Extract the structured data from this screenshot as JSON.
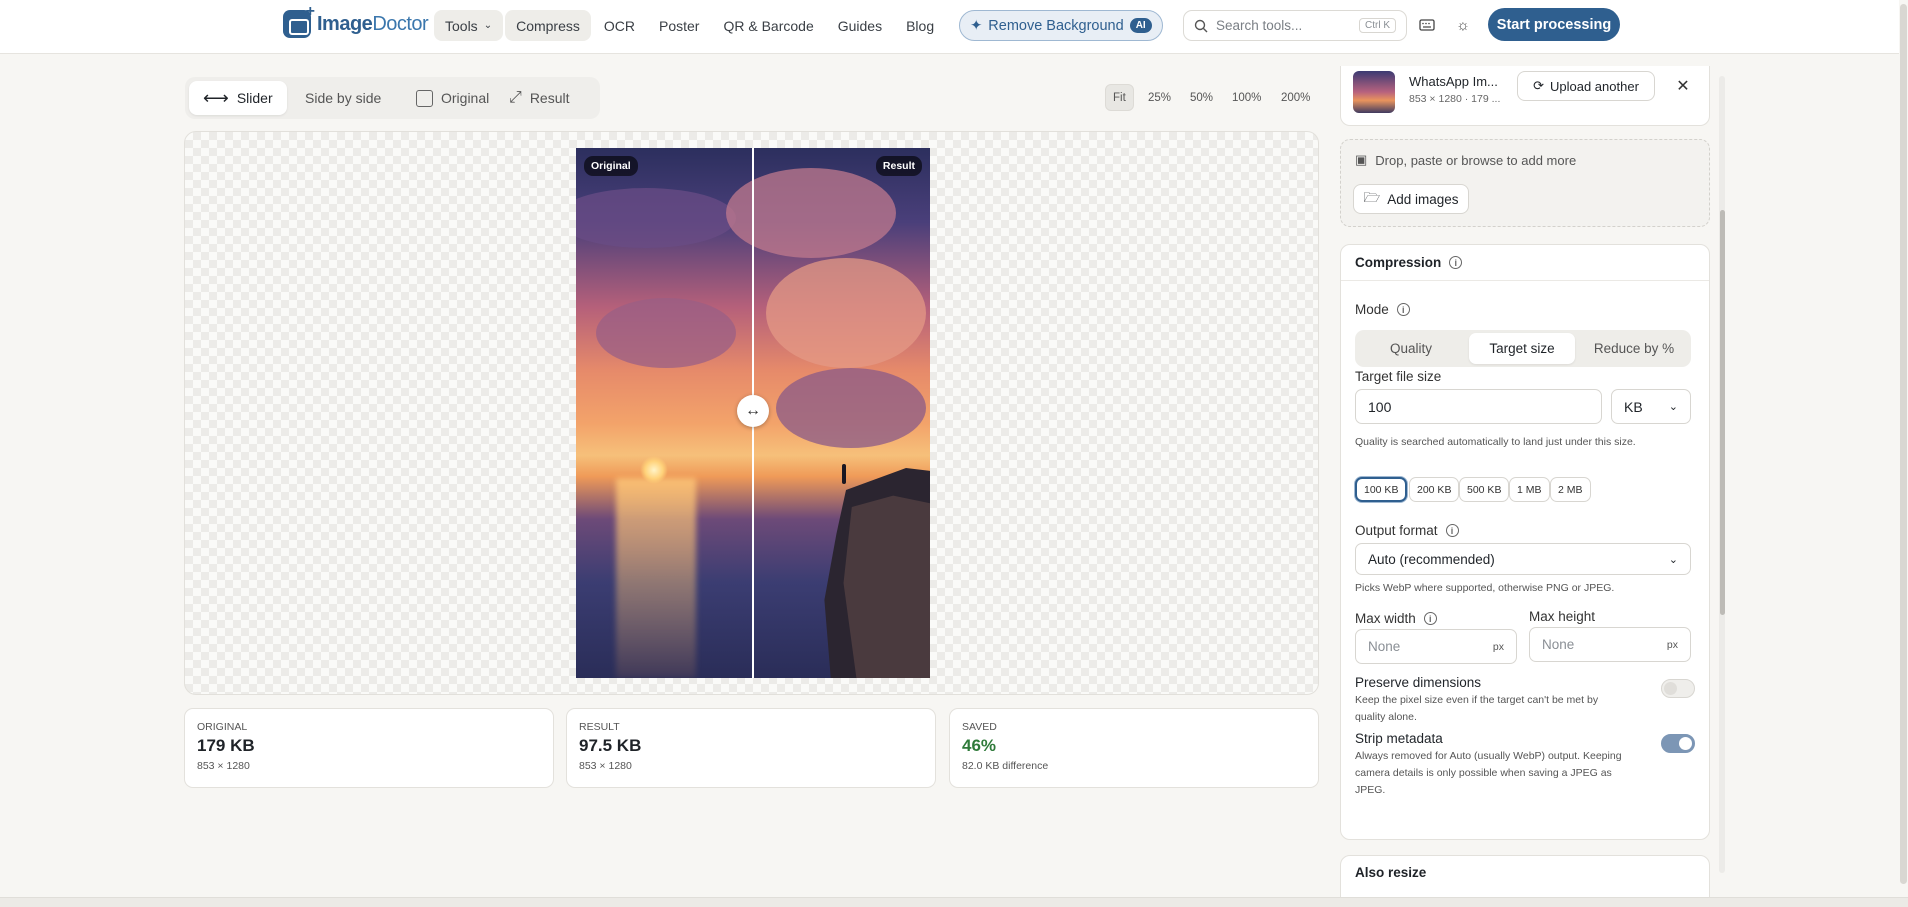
{
  "header": {
    "logo_a": "Image",
    "logo_b": "Doctor",
    "nav": [
      {
        "label": "Tools"
      },
      {
        "label": "Compress"
      },
      {
        "label": "OCR"
      },
      {
        "label": "Poster"
      },
      {
        "label": "QR & Barcode"
      },
      {
        "label": "Guides"
      },
      {
        "label": "Blog"
      }
    ],
    "remove_bg": "Remove Background",
    "ai_badge": "AI",
    "search_placeholder": "Search tools...",
    "search_kbd": "Ctrl K",
    "start": "Start processing"
  },
  "view": {
    "modes": [
      "Slider",
      "Side by side",
      "Original",
      "Result"
    ],
    "zoom": [
      "Fit",
      "25%",
      "50%",
      "100%",
      "200%"
    ],
    "label_original": "Original",
    "label_result": "Result"
  },
  "stats": [
    {
      "label": "ORIGINAL",
      "value": "179 KB",
      "sub": "853 × 1280"
    },
    {
      "label": "RESULT",
      "value": "97.5 KB",
      "sub": "853 × 1280"
    },
    {
      "label": "SAVED",
      "value": "46%",
      "sub": "82.0 KB difference"
    }
  ],
  "file": {
    "name": "WhatsApp Im...",
    "meta": "853 × 1280 · 179 ...",
    "upload": "Upload another"
  },
  "drop": {
    "text": "Drop, paste or browse to add more",
    "add": "Add images"
  },
  "compression": {
    "title": "Compression",
    "mode_label": "Mode",
    "modes": [
      "Quality",
      "Target size",
      "Reduce by %"
    ],
    "target_label": "Target file size",
    "target_value": "100",
    "unit": "KB",
    "target_hint": "Quality is searched automatically to land just under this size.",
    "presets": [
      "100 KB",
      "200 KB",
      "500 KB",
      "1 MB",
      "2 MB"
    ],
    "format_label": "Output format",
    "format_value": "Auto (recommended)",
    "format_hint": "Picks WebP where supported, otherwise PNG or JPEG.",
    "max_width": "Max width",
    "max_height": "Max height",
    "none_placeholder": "None",
    "px": "px",
    "preserve_title": "Preserve dimensions",
    "preserve_hint": "Keep the pixel size even if the target can't be met by quality alone.",
    "strip_title": "Strip metadata",
    "strip_hint": "Always removed for Auto (usually WebP) output. Keeping camera details is only possible when saving a JPEG as JPEG.",
    "also_resize": "Also resize"
  }
}
